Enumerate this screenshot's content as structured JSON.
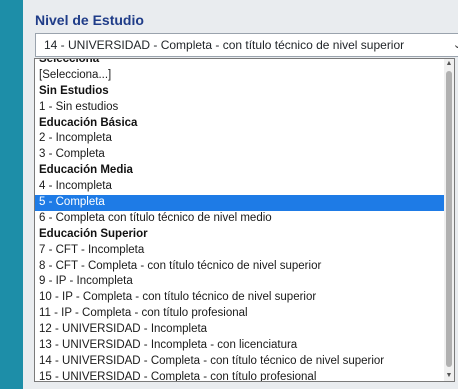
{
  "field": {
    "label": "Nivel de Estudio",
    "selected_value": "14 - UNIVERSIDAD - Completa - con título técnico de nivel superior"
  },
  "dropdown": {
    "highlighted_option": "5 - Completa",
    "options": [
      {
        "text": "Selecciona",
        "group": true
      },
      {
        "text": "[Selecciona...]",
        "group": false
      },
      {
        "text": "Sin Estudios",
        "group": true
      },
      {
        "text": "1 - Sin estudios",
        "group": false
      },
      {
        "text": "Educación Básica",
        "group": true
      },
      {
        "text": "2 - Incompleta",
        "group": false
      },
      {
        "text": "3 - Completa",
        "group": false
      },
      {
        "text": "Educación Media",
        "group": true
      },
      {
        "text": "4 - Incompleta",
        "group": false
      },
      {
        "text": "5 - Completa",
        "group": false
      },
      {
        "text": "6 - Completa con título técnico de nivel medio",
        "group": false
      },
      {
        "text": "Educación Superior",
        "group": true
      },
      {
        "text": "7 - CFT - Incompleta",
        "group": false
      },
      {
        "text": "8 - CFT - Completa - con título técnico de nivel superior",
        "group": false
      },
      {
        "text": "9 - IP - Incompleta",
        "group": false
      },
      {
        "text": "10 - IP - Completa - con título técnico de nivel superior",
        "group": false
      },
      {
        "text": "11 - IP - Completa - con título profesional",
        "group": false
      },
      {
        "text": "12 - UNIVERSIDAD - Incompleta",
        "group": false
      },
      {
        "text": "13 - UNIVERSIDAD - Incompleta - con licenciatura",
        "group": false
      },
      {
        "text": "14 - UNIVERSIDAD - Completa - con título técnico de nivel superior",
        "group": false
      },
      {
        "text": "15 - UNIVERSIDAD - Completa - con título profesional",
        "group": false
      }
    ]
  },
  "colors": {
    "background": "#1d8ea8",
    "label": "#1f3c88",
    "highlight": "#1e7be6"
  }
}
